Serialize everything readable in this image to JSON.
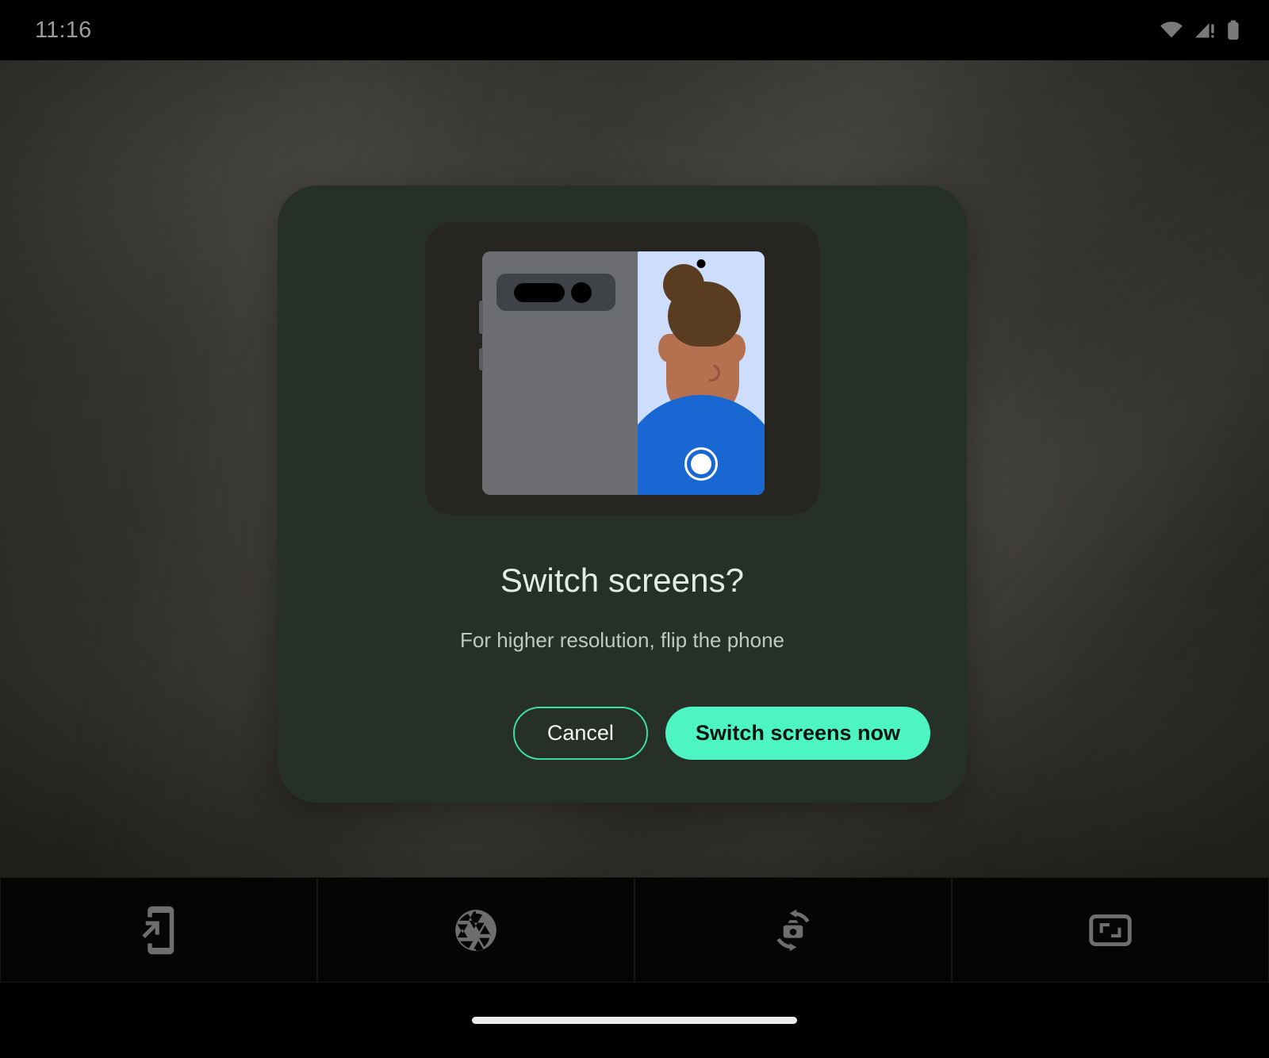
{
  "status_bar": {
    "time": "11:16",
    "icons": [
      {
        "name": "wifi-icon",
        "label": "Wi-Fi connected"
      },
      {
        "name": "cellular-signal-warning-icon",
        "label": "Mobile signal, no service"
      },
      {
        "name": "battery-icon",
        "label": "Battery full"
      }
    ]
  },
  "dialog": {
    "title": "Switch screens?",
    "subtitle": "For higher resolution, flip the phone",
    "cancel_label": "Cancel",
    "confirm_label": "Switch screens now",
    "illustration": {
      "name": "foldable-phone-selfie-illustration",
      "description": "Foldable phone shown from the back with camera bar, cover screen previewing a person and a shutter button"
    }
  },
  "toolbar": {
    "items": [
      {
        "name": "switch-to-cover-screen-icon",
        "label": "Switch screen"
      },
      {
        "name": "camera-shutter-aperture-icon",
        "label": "Shutter"
      },
      {
        "name": "flip-camera-icon",
        "label": "Flip camera"
      },
      {
        "name": "aspect-ratio-icon",
        "label": "Aspect ratio"
      }
    ]
  },
  "navigation": {
    "gesture_pill": "home-gesture-pill"
  },
  "colors": {
    "accent_green": "#4cf5c2",
    "outline_green": "#3ddba5",
    "dialog_surface": "#263029",
    "illustration_surface": "#262522",
    "avatar_skin": "#b5714f",
    "avatar_hair": "#5a3c20",
    "avatar_shirt": "#1967d2",
    "device_body": "#6b6d71",
    "device_screen": "#ccdefb",
    "status_text": "#9b9b9b",
    "title_text": "#e3ece1",
    "subtitle_text": "#bfc9c1",
    "toolbar_icon": "#6e6e6e",
    "nav_pill": "#ededed"
  }
}
